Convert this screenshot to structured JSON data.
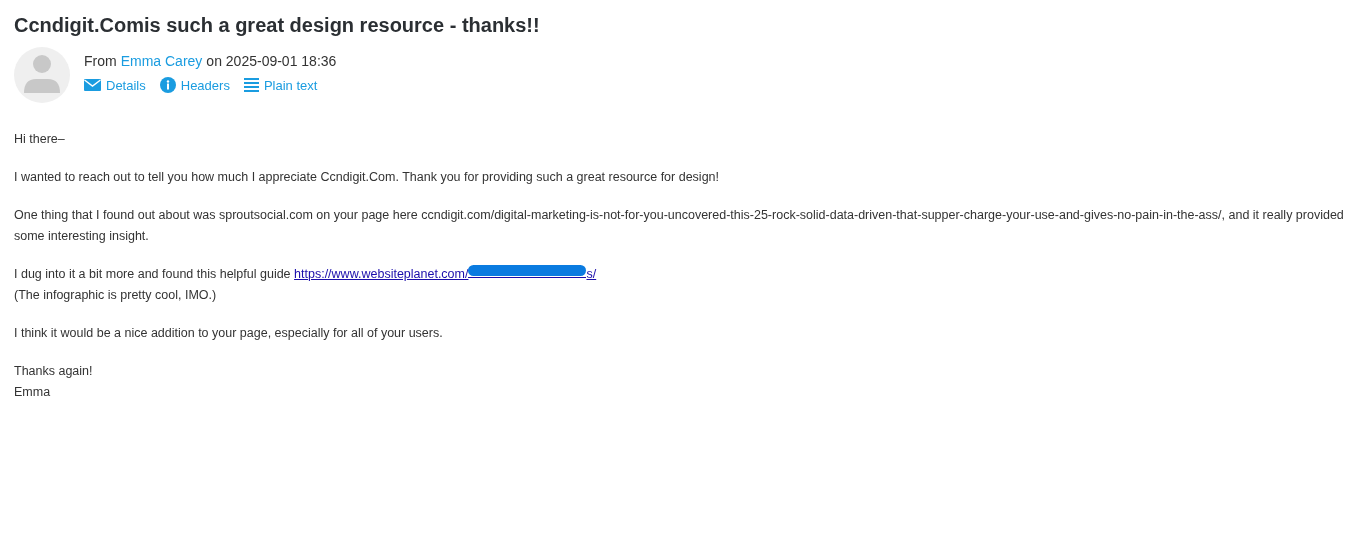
{
  "subject": "Ccndigit.Comis such a great design resource - thanks!!",
  "sender": {
    "prefix": "From",
    "name": "Emma Carey",
    "date_prefix": "on",
    "date": "2025-09-01 18:36"
  },
  "actions": [
    {
      "kind": "details",
      "label": "Details"
    },
    {
      "kind": "headers",
      "label": "Headers"
    },
    {
      "kind": "plain",
      "label": "Plain text"
    }
  ],
  "body": [
    {
      "lines": [
        {
          "text": "Hi there–"
        }
      ]
    },
    {
      "lines": [
        {
          "text": "I wanted to reach out to tell you how much I appreciate Ccndigit.Com. Thank you for providing such a great resource for design!"
        }
      ]
    },
    {
      "lines": [
        {
          "text": "One thing that I found out about was sproutsocial.com on your page here ccndigit.com/digital-marketing-is-not-for-you-uncovered-this-25-rock-solid-data-driven-that-supper-charge-your-use-and-gives-no-pain-in-the-ass/, and it really provided some interesting insight."
        }
      ]
    },
    {
      "lines": [
        {
          "text": "I dug into it a bit more and found this helpful guide",
          "link": {
            "start": "https://www.websiteplanet.com/",
            "end": "s/",
            "redacted": true
          }
        },
        {
          "text": "(The infographic is pretty cool, IMO.)"
        }
      ]
    },
    {
      "lines": [
        {
          "text": "I think it would be a nice addition to your page, especially for all of your users."
        }
      ]
    },
    {
      "lines": [
        {
          "text": "Thanks again!"
        },
        {
          "text": "Emma"
        }
      ]
    }
  ]
}
